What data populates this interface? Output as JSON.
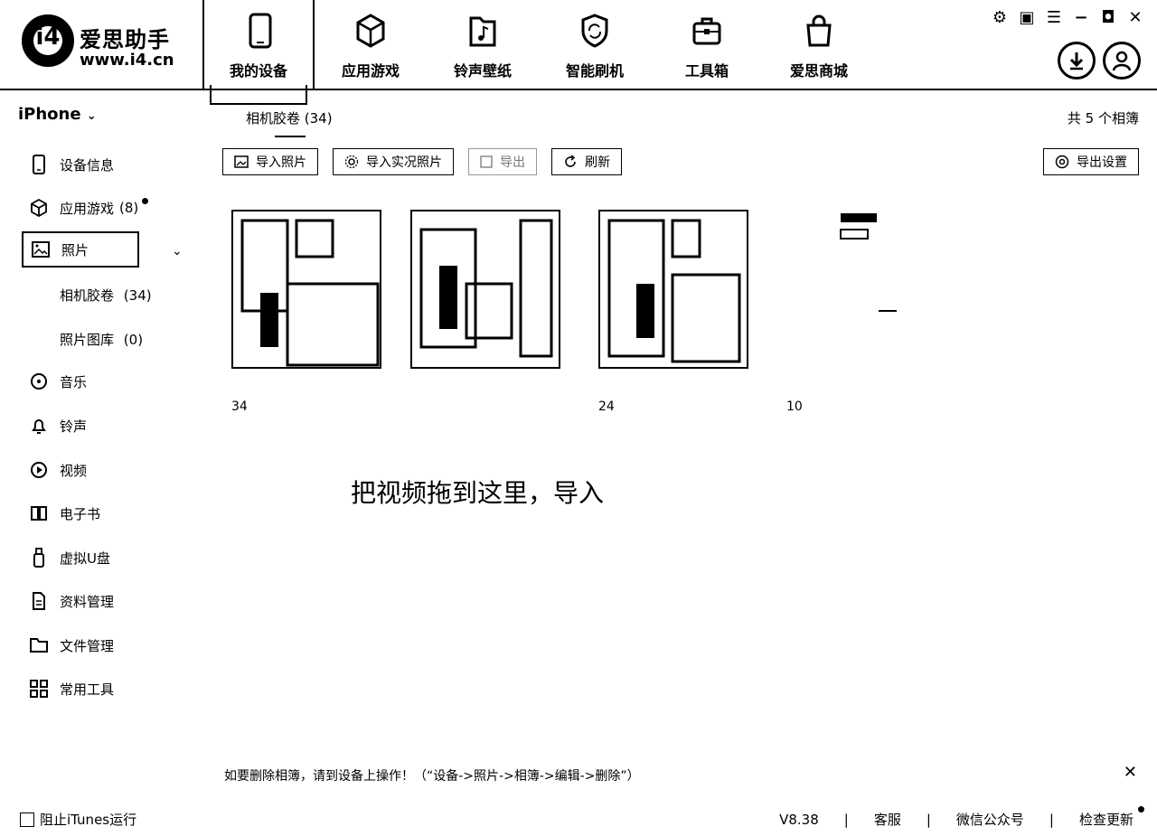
{
  "app": {
    "name": "爱思助手",
    "url": "www.i4.cn",
    "logo_mark": "i4"
  },
  "nav": [
    {
      "label": "我的设备",
      "icon": "phone-icon",
      "active": true
    },
    {
      "label": "应用游戏",
      "icon": "cube-icon"
    },
    {
      "label": "铃声壁纸",
      "icon": "music-folder-icon"
    },
    {
      "label": "智能刷机",
      "icon": "refresh-shield-icon"
    },
    {
      "label": "工具箱",
      "icon": "toolbox-icon"
    },
    {
      "label": "爱思商城",
      "icon": "shopping-bag-icon"
    }
  ],
  "sidebar": {
    "device": "iPhone",
    "items": [
      {
        "label": "设备信息",
        "icon": "phone-icon"
      },
      {
        "label": "应用游戏",
        "count": "(8)",
        "icon": "cube-icon",
        "badge": true
      },
      {
        "label": "照片",
        "icon": "image-icon",
        "active": true
      },
      {
        "label": "音乐",
        "icon": "music-disc-icon"
      },
      {
        "label": "铃声",
        "icon": "bell-icon"
      },
      {
        "label": "视频",
        "icon": "play-icon"
      },
      {
        "label": "电子书",
        "icon": "book-icon"
      },
      {
        "label": "虚拟U盘",
        "icon": "usb-icon"
      },
      {
        "label": "资料管理",
        "icon": "document-icon"
      },
      {
        "label": "文件管理",
        "icon": "folder-icon"
      },
      {
        "label": "常用工具",
        "icon": "grid-icon"
      }
    ],
    "photo_subitems": [
      {
        "label": "相机胶卷",
        "count": "(34)"
      },
      {
        "label": "照片图库",
        "count": "(0)"
      }
    ]
  },
  "main": {
    "tab": "相机胶卷 (34)",
    "album_count": "共 5 个相簿",
    "toolbar": {
      "import_photos": "导入照片",
      "import_live": "导入实况照片",
      "export": "导出",
      "refresh": "刷新",
      "export_settings": "导出设置"
    },
    "albums": [
      {
        "count": "34"
      },
      {
        "count": ""
      },
      {
        "count": "24"
      },
      {
        "count": "10"
      },
      {
        "count": ""
      }
    ],
    "drop_hint": "把视频拖到这里，导入",
    "tip": "如要删除相簿，请到设备上操作！（“设备->照片->相簿->编辑->删除”）"
  },
  "statusbar": {
    "block_itunes": "阻止iTunes运行",
    "version": "V8.38",
    "service": "客服",
    "wechat": "微信公众号",
    "update": "检查更新"
  }
}
